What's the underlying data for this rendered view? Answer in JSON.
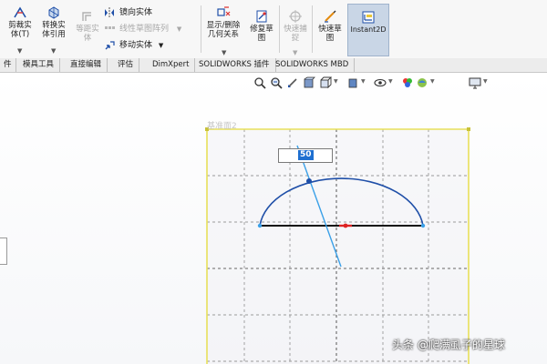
{
  "ribbon": {
    "cut_entities": "剪裁实\n体(T)",
    "convert_entities": "转换实\n体引用",
    "offset_entities": "等距实\n体",
    "mirror_entities": "镜向实体",
    "linear_pattern": "线性草图阵列",
    "move_entities": "移动实体",
    "display_delete_relations": "显示/删除\n几何关系",
    "repair_sketch": "修复草\n图",
    "quick_snaps": "快速捕\n捉",
    "rapid_sketch": "快速草\n图",
    "instant2d": "Instant2D"
  },
  "tabs": [
    "件",
    "模具工具",
    "直接编辑",
    "评估",
    "DimXpert",
    "SOLIDWORKS 插件",
    "SOLIDWORKS MBD"
  ],
  "heads_up_icons": [
    "zoom-to-fit-icon",
    "zoom-area-icon",
    "previous-view-icon",
    "section-view-icon",
    "view-orientation-icon",
    "display-style-icon",
    "hide-show-icon",
    "edit-appearance-icon",
    "apply-scene-icon",
    "view-settings-icon"
  ],
  "canvas": {
    "plane_label": "基准面2",
    "dimension_value": "50"
  },
  "watermark": "头条 @爬满虱子的星球",
  "colors": {
    "sketch_line": "#1f4fa8",
    "construction": "#3aa0e8",
    "plane_border": "#e8e05a",
    "selection": "#1e6fd0"
  }
}
